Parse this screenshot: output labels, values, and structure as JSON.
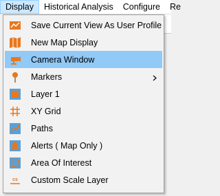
{
  "menubar": {
    "items": [
      {
        "label": "Display"
      },
      {
        "label": "Historical Analysis"
      },
      {
        "label": "Configure"
      },
      {
        "label": "Re"
      }
    ]
  },
  "menu": {
    "items": [
      {
        "label": "Save Current View As User Profile",
        "icon": "save-profile-icon"
      },
      {
        "label": "New Map Display",
        "icon": "map-icon"
      },
      {
        "label": "Camera Window",
        "icon": "camera-icon",
        "highlighted": true
      },
      {
        "label": "Markers",
        "icon": "marker-pin-icon",
        "submenu": true
      },
      {
        "label": "Layer 1",
        "icon": "layer-icon"
      },
      {
        "label": "XY Grid",
        "icon": "grid-icon"
      },
      {
        "label": "Paths",
        "icon": "path-icon"
      },
      {
        "label": "Alerts ( Map Only )",
        "icon": "alert-bell-icon"
      },
      {
        "label": "Area Of Interest",
        "icon": "area-of-interest-icon"
      },
      {
        "label": "Custom Scale Layer",
        "icon": "custom-scale-icon",
        "icon_text": "cs"
      }
    ]
  },
  "colors": {
    "icon_orange": "#e8771d",
    "icon_blue": "#5aa0d8",
    "highlight": "#91c9f7"
  }
}
